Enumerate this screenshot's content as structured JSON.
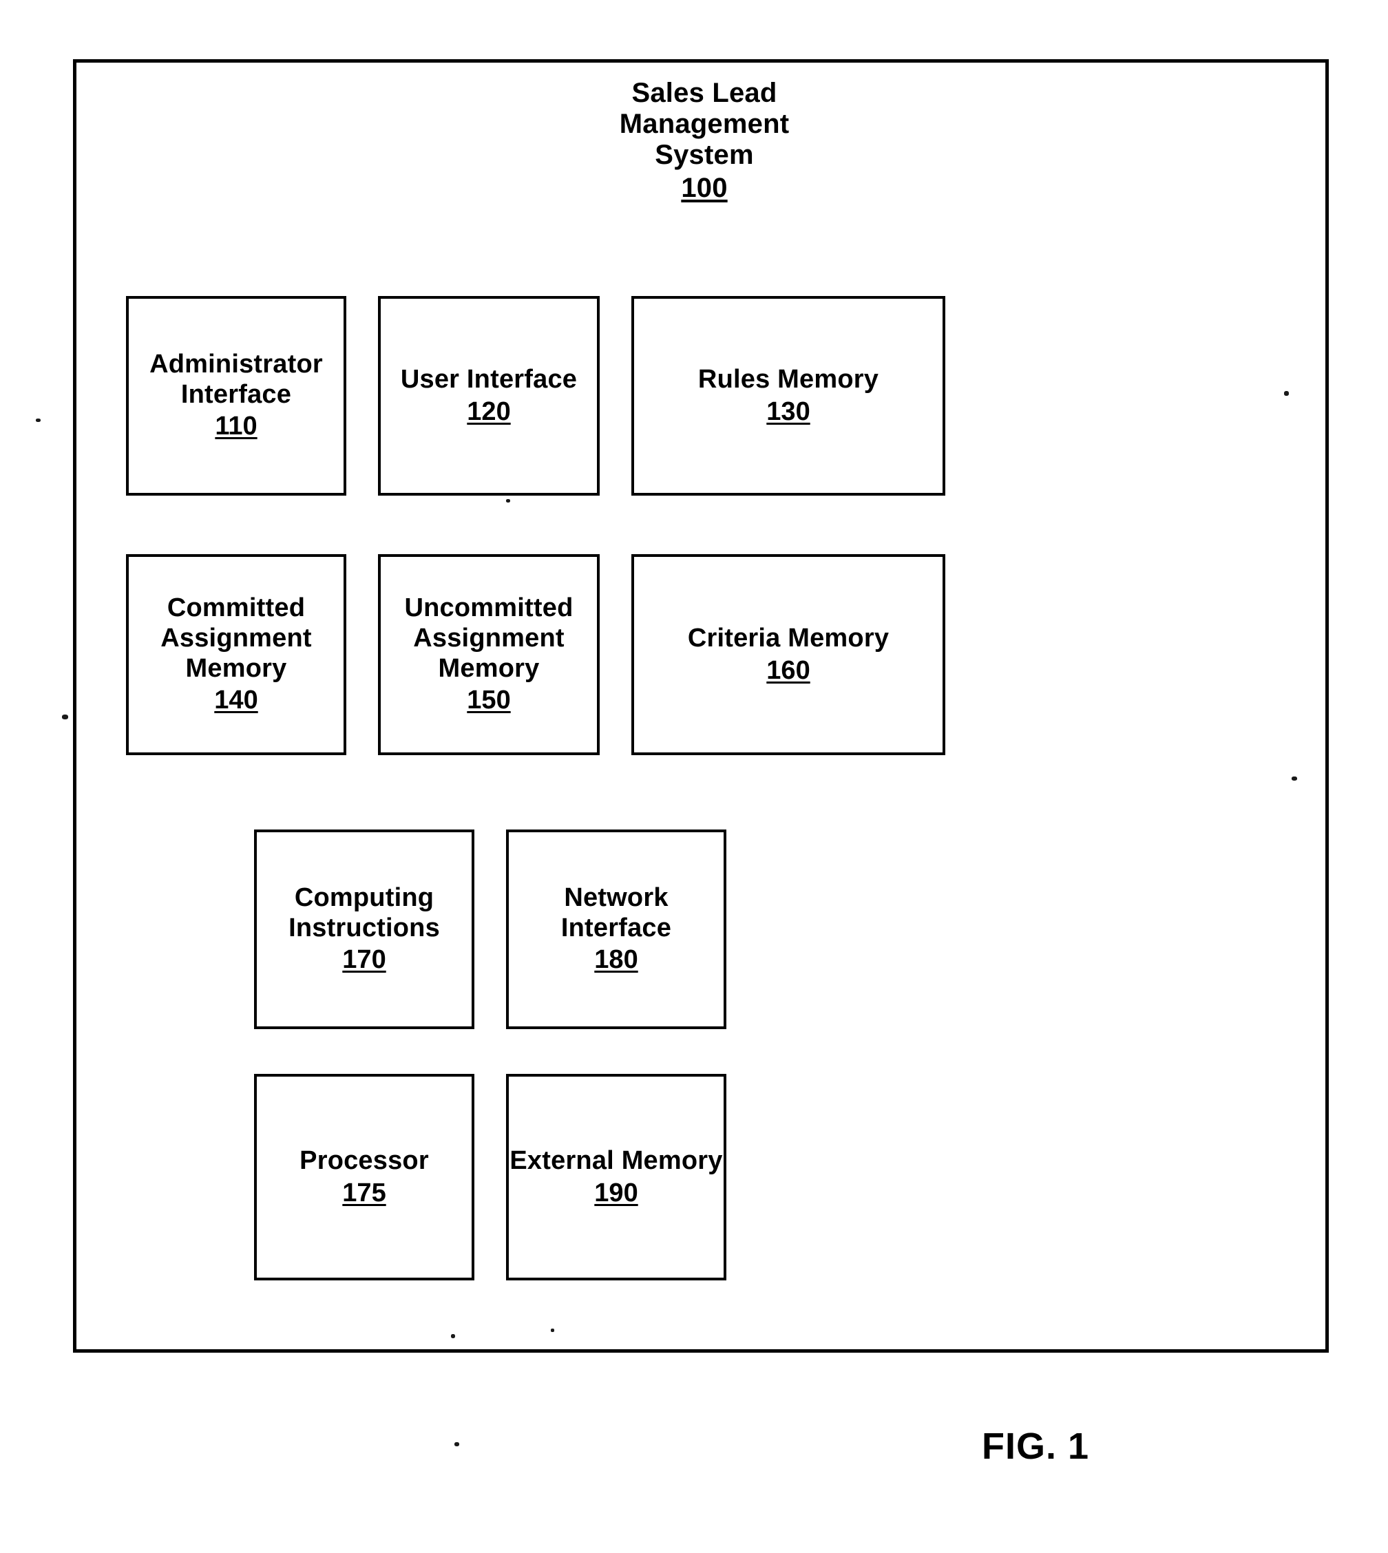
{
  "figure": {
    "caption": "FIG. 1"
  },
  "system": {
    "title_lines": "Sales Lead\nManagement\nSystem",
    "title_line_1": "Sales Lead",
    "title_line_2": "Management",
    "title_line_3": "System",
    "reference_number": "100"
  },
  "components": [
    {
      "id": "administrator-interface",
      "label": "Administrator\nInterface",
      "reference_number": "110",
      "row": 1,
      "column": 1
    },
    {
      "id": "user-interface",
      "label": "User Interface",
      "reference_number": "120",
      "row": 1,
      "column": 2
    },
    {
      "id": "rules-memory",
      "label": "Rules Memory",
      "reference_number": "130",
      "row": 1,
      "column": 3
    },
    {
      "id": "committed-assignment-memory",
      "label": "Committed\nAssignment\nMemory",
      "reference_number": "140",
      "row": 2,
      "column": 1
    },
    {
      "id": "uncommitted-assignment-memory",
      "label": "Uncommitted\nAssignment\nMemory",
      "reference_number": "150",
      "row": 2,
      "column": 2
    },
    {
      "id": "criteria-memory",
      "label": "Criteria Memory",
      "reference_number": "160",
      "row": 2,
      "column": 3
    },
    {
      "id": "computing-instructions",
      "label": "Computing\nInstructions",
      "reference_number": "170",
      "row": 3,
      "column": 1
    },
    {
      "id": "network-interface",
      "label": "Network\nInterface",
      "reference_number": "180",
      "row": 3,
      "column": 2
    },
    {
      "id": "processor",
      "label": "Processor",
      "reference_number": "175",
      "row": 4,
      "column": 1
    },
    {
      "id": "external-memory",
      "label": "External Memory",
      "reference_number": "190",
      "row": 4,
      "column": 2
    }
  ],
  "colors": {
    "ink": "#000000",
    "paper": "#ffffff"
  }
}
